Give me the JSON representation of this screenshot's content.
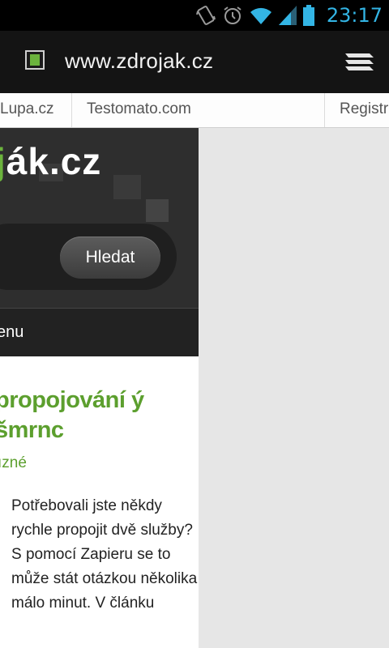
{
  "status_bar": {
    "time": "23:17",
    "icons": [
      "vibrate-icon",
      "alarm-icon",
      "wifi-icon",
      "signal-icon",
      "battery-icon"
    ],
    "accent": "#33b5e5"
  },
  "browser": {
    "url": "www.zdrojak.cz",
    "bookmarks": [
      "Lupa.cz",
      "Testomato.com",
      "Registr"
    ]
  },
  "page": {
    "logo": {
      "text_green": "j",
      "text_rest": "ák.cz"
    },
    "search_button": "Hledat",
    "nav_label": "enu",
    "article": {
      "title": "propojování ý šmrnc",
      "category": "ızné",
      "body": "Potřebovali jste někdy rychle propojit dvě služby? S pomocí Zapieru se to může stát otázkou několika málo minut. V článku"
    },
    "colors": {
      "green": "#5c9f2e",
      "header_bg": "#2e2e2e"
    }
  }
}
